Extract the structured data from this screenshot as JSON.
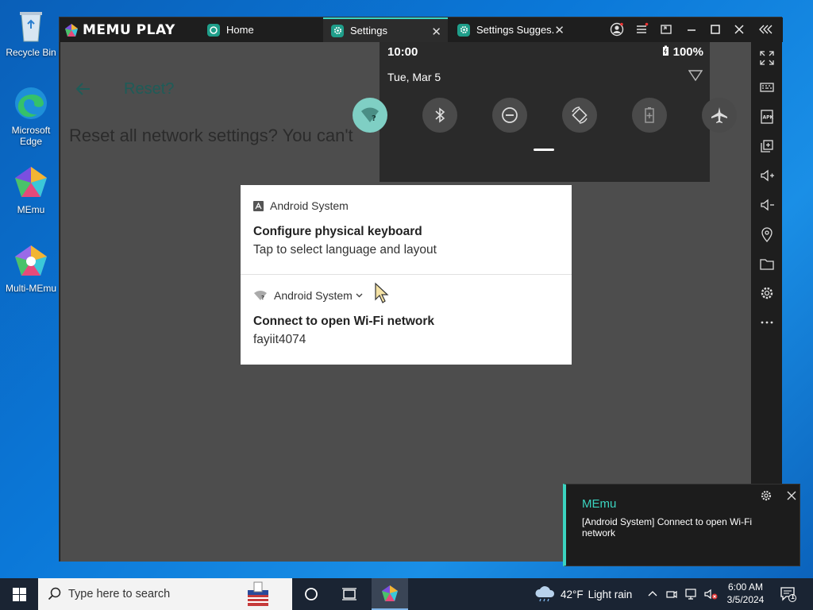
{
  "desktop": {
    "icons": [
      {
        "label": "Recycle Bin"
      },
      {
        "label": "Microsoft Edge"
      },
      {
        "label": "MEmu"
      },
      {
        "label": "Multi-MEmu"
      }
    ]
  },
  "memu": {
    "logo_text": "MEMU PLAY",
    "tabs": [
      {
        "label": "Home"
      },
      {
        "label": "Settings"
      },
      {
        "label": "Settings Sugges."
      }
    ]
  },
  "android": {
    "page_title": "Reset?",
    "page_body": "Reset all network settings? You can't",
    "status_time": "10:00",
    "battery": "100%",
    "date": "Tue, Mar 5",
    "notifications": [
      {
        "app": "Android System",
        "title": "Configure physical keyboard",
        "text": "Tap to select language and layout"
      },
      {
        "app": "Android System",
        "title": "Connect to open Wi-Fi network",
        "text": "fayiit4074"
      }
    ]
  },
  "toast": {
    "title": "MEmu",
    "message": "[Android System] Connect to open Wi-Fi network"
  },
  "taskbar": {
    "search_placeholder": "Type here to search",
    "weather_temp": "42°F",
    "weather_text": "Light rain",
    "time": "6:00 AM",
    "date": "3/5/2024",
    "notif_count": "1"
  },
  "colors": {
    "accent": "#3bd4c0",
    "screen_bg": "#4d4d4d",
    "qs_bg": "#2a2a2a",
    "taskbar": "#1a2433"
  }
}
